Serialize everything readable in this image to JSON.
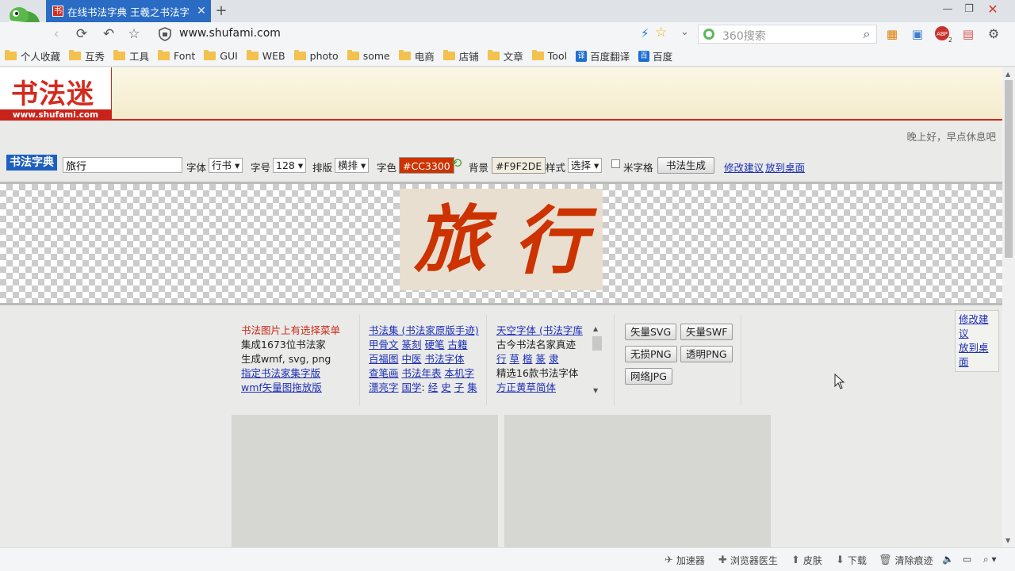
{
  "browser": {
    "tab_title": "在线书法字典 王羲之书法字",
    "tab_favicon_text": "书",
    "url": "www.shufami.com",
    "search_placeholder": "360搜索"
  },
  "bookmarks": [
    {
      "label": "个人收藏",
      "icon": "folder-icon"
    },
    {
      "label": "互秀",
      "icon": "folder-icon"
    },
    {
      "label": "工具",
      "icon": "folder-icon"
    },
    {
      "label": "Font",
      "icon": "folder-icon"
    },
    {
      "label": "GUI",
      "icon": "folder-icon"
    },
    {
      "label": "WEB",
      "icon": "folder-icon"
    },
    {
      "label": "photo",
      "icon": "folder-icon"
    },
    {
      "label": "some",
      "icon": "folder-icon"
    },
    {
      "label": "电商",
      "icon": "folder-icon"
    },
    {
      "label": "店铺",
      "icon": "folder-icon"
    },
    {
      "label": "文章",
      "icon": "folder-icon"
    },
    {
      "label": "Tool",
      "icon": "folder-icon"
    },
    {
      "label": "百度翻译",
      "icon": "translate-icon"
    },
    {
      "label": "百度",
      "icon": "baidu-paw-icon"
    }
  ],
  "site": {
    "logo_text": "书法迷",
    "logo_domain": "www.shufami.com",
    "greeting": "晚上好，早点休息吧",
    "accent_color": "#cc2a1a"
  },
  "toolbar": {
    "title": "书法字典",
    "text_value": "旅行",
    "font_label": "字体",
    "font_value": "行书",
    "size_label": "字号",
    "size_value": "128",
    "layout_label": "排版",
    "layout_value": "横排",
    "color_label": "字色",
    "color_value": "#CC3300",
    "bg_label": "背景",
    "bg_value": "#F9F2DE",
    "style_label": "样式",
    "style_value": "选择",
    "grid_label": "米字格",
    "generate_button": "书法生成",
    "suggest_link": "修改建议",
    "desktop_link": "放到桌面"
  },
  "artwork": {
    "text": "旅行",
    "ink_color": "#cc3300",
    "paper_color": "#e9dfd0"
  },
  "info": {
    "col1": [
      "书法图片上有选择菜单",
      "集成1673位书法家",
      "生成wmf, svg, png",
      "指定书法家集字版",
      "wmf矢量图拖放版"
    ],
    "col2": [
      [
        {
          "t": "书法集 (书法家原版手迹)",
          "link": true
        }
      ],
      [
        {
          "t": "甲骨文",
          "link": true
        },
        {
          "t": " ",
          "link": false
        },
        {
          "t": "篆刻",
          "link": true
        },
        {
          "t": " ",
          "link": false
        },
        {
          "t": "硬笔",
          "link": true
        },
        {
          "t": " ",
          "link": false
        },
        {
          "t": "古籍",
          "link": true
        }
      ],
      [
        {
          "t": "百福图",
          "link": true
        },
        {
          "t": " ",
          "link": false
        },
        {
          "t": "中医",
          "link": true
        },
        {
          "t": " ",
          "link": false
        },
        {
          "t": "书法字体",
          "link": true
        }
      ],
      [
        {
          "t": "查笔画",
          "link": true
        },
        {
          "t": " ",
          "link": false
        },
        {
          "t": "书法年表",
          "link": true
        },
        {
          "t": " ",
          "link": false
        },
        {
          "t": "本机字",
          "link": true
        }
      ],
      [
        {
          "t": "漂亮字",
          "link": true
        },
        {
          "t": " ",
          "link": false
        },
        {
          "t": "国学",
          "link": true
        },
        {
          "t": ": ",
          "link": false
        },
        {
          "t": "经",
          "link": true
        },
        {
          "t": " ",
          "link": false
        },
        {
          "t": "史",
          "link": true
        },
        {
          "t": " ",
          "link": false
        },
        {
          "t": "子",
          "link": true
        },
        {
          "t": " ",
          "link": false
        },
        {
          "t": "集",
          "link": true
        }
      ]
    ],
    "col3": [
      [
        {
          "t": "天空字体 (书法字库",
          "link": true
        }
      ],
      [
        {
          "t": "古今书法名家真迹",
          "link": false
        }
      ],
      [
        {
          "t": "行",
          "link": true
        },
        {
          "t": " ",
          "link": false
        },
        {
          "t": "草",
          "link": true
        },
        {
          "t": " ",
          "link": false
        },
        {
          "t": "楷",
          "link": true
        },
        {
          "t": " ",
          "link": false
        },
        {
          "t": "篆",
          "link": true
        },
        {
          "t": " ",
          "link": false
        },
        {
          "t": "隶",
          "link": true
        }
      ],
      [
        {
          "t": "精选16款书法字体",
          "link": false
        }
      ],
      [
        {
          "t": "方正黄草简体",
          "link": true
        }
      ]
    ],
    "export_buttons": [
      "矢量SVG",
      "矢量SWF",
      "无损PNG",
      "透明PNG",
      "网络JPG"
    ],
    "float_suggest": "修改建议",
    "float_desktop": "放到桌面"
  },
  "statusbar": {
    "accelerator": "加速器",
    "doctor": "浏览器医生",
    "skin": "皮肤",
    "download": "下载",
    "clear": "清除痕迹"
  }
}
